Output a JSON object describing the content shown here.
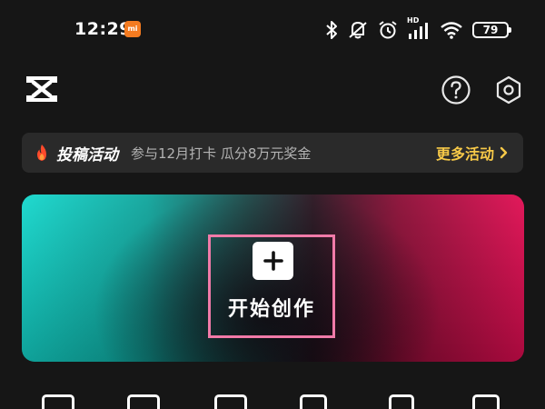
{
  "status_bar": {
    "time": "12:29",
    "app_badge": "mi",
    "hd_label": "HD",
    "battery": "79",
    "icons": [
      "bluetooth-icon",
      "mute-vibrate-icon",
      "alarm-icon",
      "signal-icon",
      "wifi-icon",
      "battery-icon"
    ]
  },
  "header": {
    "logo_icon": "capcut-logo",
    "help_icon": "help-circle-icon",
    "settings_icon": "settings-hexagon-icon"
  },
  "banner": {
    "icon": "flame-icon",
    "title": "投稿活动",
    "description": "参与12月打卡 瓜分8万元奖金",
    "more_label": "更多活动",
    "more_icon": "chevron-right-icon"
  },
  "create": {
    "icon": "plus-icon",
    "label": "开始创作"
  },
  "tools": {
    "icons": [
      "tool-1-icon",
      "tool-2-icon",
      "tool-3-icon",
      "tool-4-icon",
      "tool-5-icon",
      "tool-6-icon"
    ]
  },
  "colors": {
    "background": "#161616",
    "banner_bg": "#2a2a2a",
    "accent_yellow": "#f7c948",
    "highlight_pink": "#f07aa8",
    "gradient_teal": "#14d8cd",
    "gradient_red": "#e10d52"
  }
}
